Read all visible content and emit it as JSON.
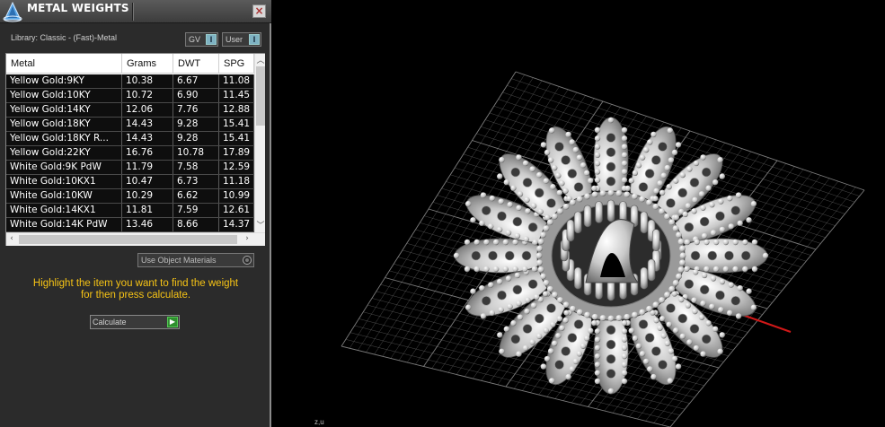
{
  "panel": {
    "title": "METAL WEIGHTS",
    "close_label": "×",
    "library_label": "Library: Classic - (Fast)-Metal",
    "toggles": [
      {
        "label": "GV",
        "knob": "I"
      },
      {
        "label": "User",
        "knob": "I"
      }
    ],
    "table": {
      "headers": [
        "Metal",
        "Grams",
        "DWT",
        "SPG"
      ],
      "rows": [
        [
          "Yellow Gold:9KY",
          "10.38",
          "6.67",
          "11.08"
        ],
        [
          "Yellow Gold:10KY",
          "10.72",
          "6.90",
          "11.45"
        ],
        [
          "Yellow Gold:14KY",
          "12.06",
          "7.76",
          "12.88"
        ],
        [
          "Yellow Gold:18KY",
          "14.43",
          "9.28",
          "15.41"
        ],
        [
          "Yellow Gold:18KY R...",
          "14.43",
          "9.28",
          "15.41"
        ],
        [
          "Yellow Gold:22KY",
          "16.76",
          "10.78",
          "17.89"
        ],
        [
          "White Gold:9K PdW",
          "11.79",
          "7.58",
          "12.59"
        ],
        [
          "White Gold:10KX1",
          "10.47",
          "6.73",
          "11.18"
        ],
        [
          "White Gold:10KW",
          "10.29",
          "6.62",
          "10.99"
        ],
        [
          "White Gold:14KX1",
          "11.81",
          "7.59",
          "12.61"
        ],
        [
          "White Gold:14K PdW",
          "13.46",
          "8.66",
          "14.37"
        ]
      ]
    },
    "use_object_materials": "Use Object Materials",
    "instruction_line1": "Highlight the item you want to find the weight",
    "instruction_line2": "for then press calculate.",
    "calculate_label": "Calculate",
    "calculate_icon": "play-icon"
  },
  "viewport": {
    "axis_label": "z,u"
  },
  "colors": {
    "instruction": "#f6c315",
    "panel_bg": "#2b2b2b",
    "row_bg": "#0e0e0e",
    "grid": "#8a8a8a",
    "x_axis": "#d01818",
    "y_axis": "#2a9fd8"
  }
}
